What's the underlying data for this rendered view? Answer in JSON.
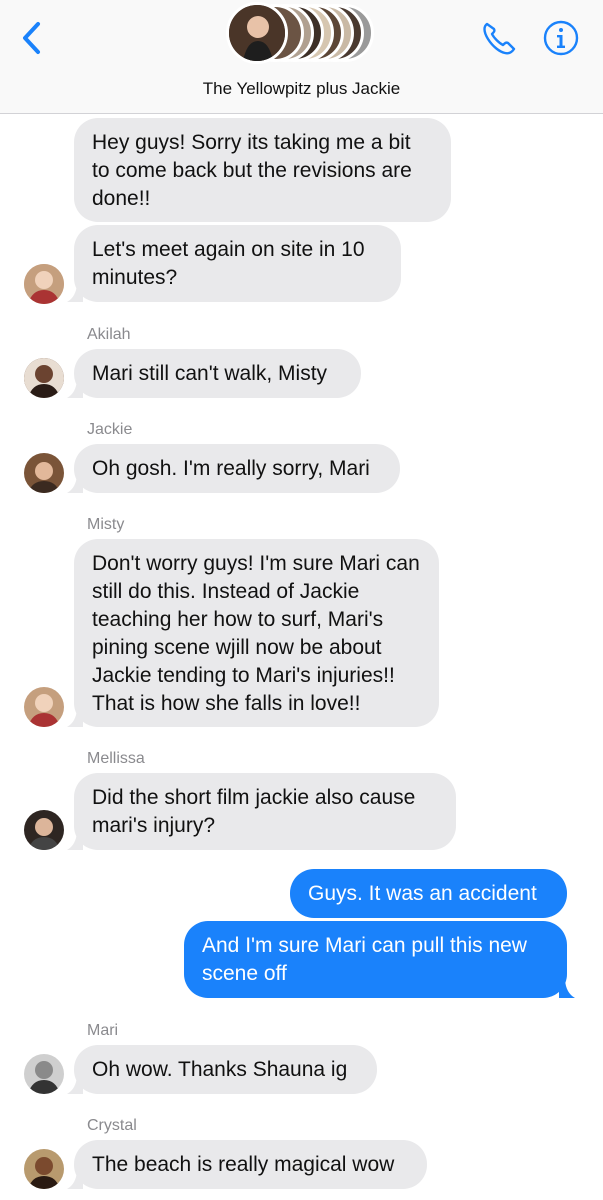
{
  "header": {
    "title": "The Yellowpitz plus Jackie",
    "back_icon": "chevron-left-icon",
    "call_icon": "phone-icon",
    "info_icon": "info-icon",
    "accent_color": "#1a82fb"
  },
  "messages": [
    {
      "sender": "",
      "text": "Hey guys! Sorry its taking me a bit to come back but the revisions are done!!",
      "direction": "in"
    },
    {
      "sender": "",
      "text": "Let's meet again on site in 10 minutes?",
      "direction": "in"
    },
    {
      "sender": "Akilah",
      "text": "Mari still can't walk, Misty",
      "direction": "in"
    },
    {
      "sender": "Jackie",
      "text": "Oh gosh. I'm really sorry, Mari",
      "direction": "in"
    },
    {
      "sender": "Misty",
      "text": "Don't worry guys! I'm sure Mari can still do this. Instead of Jackie teaching her how to surf, Mari's pining scene wjill now be about Jackie tending to Mari's injuries!! That is how she falls in love!!",
      "direction": "in"
    },
    {
      "sender": "Mellissa",
      "text": "Did the short film jackie also cause mari's injury?",
      "direction": "in"
    },
    {
      "sender": "",
      "text": "Guys. It was an accident",
      "direction": "out"
    },
    {
      "sender": "",
      "text": "And I'm sure Mari can pull this new scene off",
      "direction": "out"
    },
    {
      "sender": "Mari",
      "text": "Oh wow. Thanks Shauna ig",
      "direction": "in"
    },
    {
      "sender": "Crystal",
      "text": "The beach is really magical wow",
      "direction": "in"
    }
  ],
  "colors": {
    "incoming_bubble": "#e9e9eb",
    "outgoing_bubble": "#1a82fb",
    "sender_label": "#8a8a8e"
  }
}
